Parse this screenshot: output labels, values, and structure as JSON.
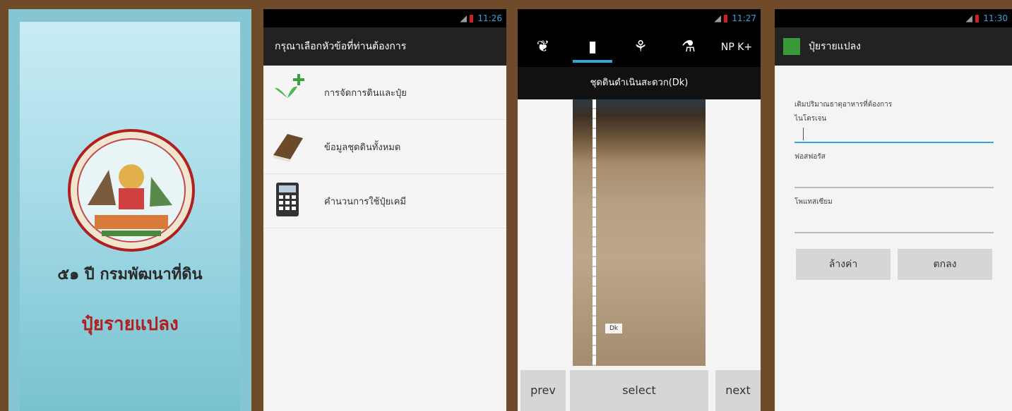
{
  "splash": {
    "title_line1": "๕๑ ปี กรมพัฒนาที่ดิน",
    "title_line2": "ปุ๋ยรายแปลง"
  },
  "menu_screen": {
    "time": "11:26",
    "header": "กรุณาเลือกหัวข้อที่ท่านต้องการ",
    "items": [
      {
        "label": "การจัดการดินและปุ๋ย",
        "icon": "plant-add-icon"
      },
      {
        "label": "ข้อมูลชุดดินทั้งหมด",
        "icon": "book-icon"
      },
      {
        "label": "คำนวนการใช้ปุ๋ยเคมี",
        "icon": "calculator-icon"
      }
    ]
  },
  "soil_screen": {
    "time": "11:27",
    "tabs": [
      {
        "icon": "plant-icon",
        "active": false
      },
      {
        "icon": "soil-profile-icon",
        "active": true
      },
      {
        "icon": "crop-icon",
        "active": false
      },
      {
        "icon": "measure-icon",
        "active": false
      },
      {
        "icon": "npk-icon",
        "active": false,
        "text": "NP K+"
      }
    ],
    "subtitle": "ชุดดินดำเนินสะดวก(Dk)",
    "profile_tag": "Dk",
    "prev_label": "prev",
    "select_label": "select",
    "next_label": "next"
  },
  "form_screen": {
    "time": "11:30",
    "app_title": "ปุ๋ยรายแปลง",
    "instruction": "เติมปริมาณธาตุอาหารที่ต้องการ",
    "fields": [
      {
        "label": "ไนโตรเจน",
        "value": ""
      },
      {
        "label": "ฟอสฟอรัส",
        "value": ""
      },
      {
        "label": "โพแทสเซียม",
        "value": ""
      }
    ],
    "clear_label": "ล้างค่า",
    "ok_label": "ตกลง"
  },
  "colors": {
    "frame": "#6f4b2a",
    "accent": "#2ea7dd",
    "splash_title": "#b02020"
  }
}
